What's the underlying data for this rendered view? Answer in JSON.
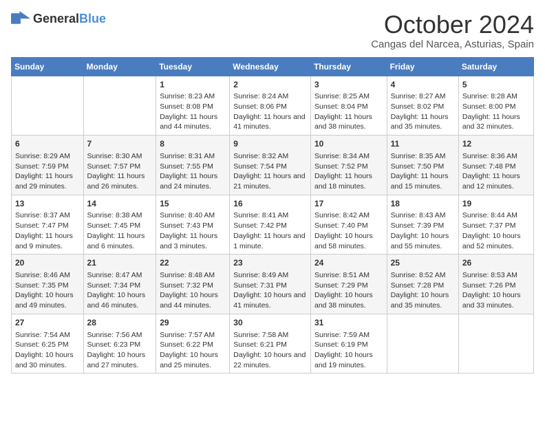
{
  "header": {
    "logo_general": "General",
    "logo_blue": "Blue",
    "month": "October 2024",
    "location": "Cangas del Narcea, Asturias, Spain"
  },
  "days_of_week": [
    "Sunday",
    "Monday",
    "Tuesday",
    "Wednesday",
    "Thursday",
    "Friday",
    "Saturday"
  ],
  "weeks": [
    [
      {
        "day": "",
        "sunrise": "",
        "sunset": "",
        "daylight": ""
      },
      {
        "day": "",
        "sunrise": "",
        "sunset": "",
        "daylight": ""
      },
      {
        "day": "1",
        "sunrise": "Sunrise: 8:23 AM",
        "sunset": "Sunset: 8:08 PM",
        "daylight": "Daylight: 11 hours and 44 minutes."
      },
      {
        "day": "2",
        "sunrise": "Sunrise: 8:24 AM",
        "sunset": "Sunset: 8:06 PM",
        "daylight": "Daylight: 11 hours and 41 minutes."
      },
      {
        "day": "3",
        "sunrise": "Sunrise: 8:25 AM",
        "sunset": "Sunset: 8:04 PM",
        "daylight": "Daylight: 11 hours and 38 minutes."
      },
      {
        "day": "4",
        "sunrise": "Sunrise: 8:27 AM",
        "sunset": "Sunset: 8:02 PM",
        "daylight": "Daylight: 11 hours and 35 minutes."
      },
      {
        "day": "5",
        "sunrise": "Sunrise: 8:28 AM",
        "sunset": "Sunset: 8:00 PM",
        "daylight": "Daylight: 11 hours and 32 minutes."
      }
    ],
    [
      {
        "day": "6",
        "sunrise": "Sunrise: 8:29 AM",
        "sunset": "Sunset: 7:59 PM",
        "daylight": "Daylight: 11 hours and 29 minutes."
      },
      {
        "day": "7",
        "sunrise": "Sunrise: 8:30 AM",
        "sunset": "Sunset: 7:57 PM",
        "daylight": "Daylight: 11 hours and 26 minutes."
      },
      {
        "day": "8",
        "sunrise": "Sunrise: 8:31 AM",
        "sunset": "Sunset: 7:55 PM",
        "daylight": "Daylight: 11 hours and 24 minutes."
      },
      {
        "day": "9",
        "sunrise": "Sunrise: 8:32 AM",
        "sunset": "Sunset: 7:54 PM",
        "daylight": "Daylight: 11 hours and 21 minutes."
      },
      {
        "day": "10",
        "sunrise": "Sunrise: 8:34 AM",
        "sunset": "Sunset: 7:52 PM",
        "daylight": "Daylight: 11 hours and 18 minutes."
      },
      {
        "day": "11",
        "sunrise": "Sunrise: 8:35 AM",
        "sunset": "Sunset: 7:50 PM",
        "daylight": "Daylight: 11 hours and 15 minutes."
      },
      {
        "day": "12",
        "sunrise": "Sunrise: 8:36 AM",
        "sunset": "Sunset: 7:48 PM",
        "daylight": "Daylight: 11 hours and 12 minutes."
      }
    ],
    [
      {
        "day": "13",
        "sunrise": "Sunrise: 8:37 AM",
        "sunset": "Sunset: 7:47 PM",
        "daylight": "Daylight: 11 hours and 9 minutes."
      },
      {
        "day": "14",
        "sunrise": "Sunrise: 8:38 AM",
        "sunset": "Sunset: 7:45 PM",
        "daylight": "Daylight: 11 hours and 6 minutes."
      },
      {
        "day": "15",
        "sunrise": "Sunrise: 8:40 AM",
        "sunset": "Sunset: 7:43 PM",
        "daylight": "Daylight: 11 hours and 3 minutes."
      },
      {
        "day": "16",
        "sunrise": "Sunrise: 8:41 AM",
        "sunset": "Sunset: 7:42 PM",
        "daylight": "Daylight: 11 hours and 1 minute."
      },
      {
        "day": "17",
        "sunrise": "Sunrise: 8:42 AM",
        "sunset": "Sunset: 7:40 PM",
        "daylight": "Daylight: 10 hours and 58 minutes."
      },
      {
        "day": "18",
        "sunrise": "Sunrise: 8:43 AM",
        "sunset": "Sunset: 7:39 PM",
        "daylight": "Daylight: 10 hours and 55 minutes."
      },
      {
        "day": "19",
        "sunrise": "Sunrise: 8:44 AM",
        "sunset": "Sunset: 7:37 PM",
        "daylight": "Daylight: 10 hours and 52 minutes."
      }
    ],
    [
      {
        "day": "20",
        "sunrise": "Sunrise: 8:46 AM",
        "sunset": "Sunset: 7:35 PM",
        "daylight": "Daylight: 10 hours and 49 minutes."
      },
      {
        "day": "21",
        "sunrise": "Sunrise: 8:47 AM",
        "sunset": "Sunset: 7:34 PM",
        "daylight": "Daylight: 10 hours and 46 minutes."
      },
      {
        "day": "22",
        "sunrise": "Sunrise: 8:48 AM",
        "sunset": "Sunset: 7:32 PM",
        "daylight": "Daylight: 10 hours and 44 minutes."
      },
      {
        "day": "23",
        "sunrise": "Sunrise: 8:49 AM",
        "sunset": "Sunset: 7:31 PM",
        "daylight": "Daylight: 10 hours and 41 minutes."
      },
      {
        "day": "24",
        "sunrise": "Sunrise: 8:51 AM",
        "sunset": "Sunset: 7:29 PM",
        "daylight": "Daylight: 10 hours and 38 minutes."
      },
      {
        "day": "25",
        "sunrise": "Sunrise: 8:52 AM",
        "sunset": "Sunset: 7:28 PM",
        "daylight": "Daylight: 10 hours and 35 minutes."
      },
      {
        "day": "26",
        "sunrise": "Sunrise: 8:53 AM",
        "sunset": "Sunset: 7:26 PM",
        "daylight": "Daylight: 10 hours and 33 minutes."
      }
    ],
    [
      {
        "day": "27",
        "sunrise": "Sunrise: 7:54 AM",
        "sunset": "Sunset: 6:25 PM",
        "daylight": "Daylight: 10 hours and 30 minutes."
      },
      {
        "day": "28",
        "sunrise": "Sunrise: 7:56 AM",
        "sunset": "Sunset: 6:23 PM",
        "daylight": "Daylight: 10 hours and 27 minutes."
      },
      {
        "day": "29",
        "sunrise": "Sunrise: 7:57 AM",
        "sunset": "Sunset: 6:22 PM",
        "daylight": "Daylight: 10 hours and 25 minutes."
      },
      {
        "day": "30",
        "sunrise": "Sunrise: 7:58 AM",
        "sunset": "Sunset: 6:21 PM",
        "daylight": "Daylight: 10 hours and 22 minutes."
      },
      {
        "day": "31",
        "sunrise": "Sunrise: 7:59 AM",
        "sunset": "Sunset: 6:19 PM",
        "daylight": "Daylight: 10 hours and 19 minutes."
      },
      {
        "day": "",
        "sunrise": "",
        "sunset": "",
        "daylight": ""
      },
      {
        "day": "",
        "sunrise": "",
        "sunset": "",
        "daylight": ""
      }
    ]
  ]
}
